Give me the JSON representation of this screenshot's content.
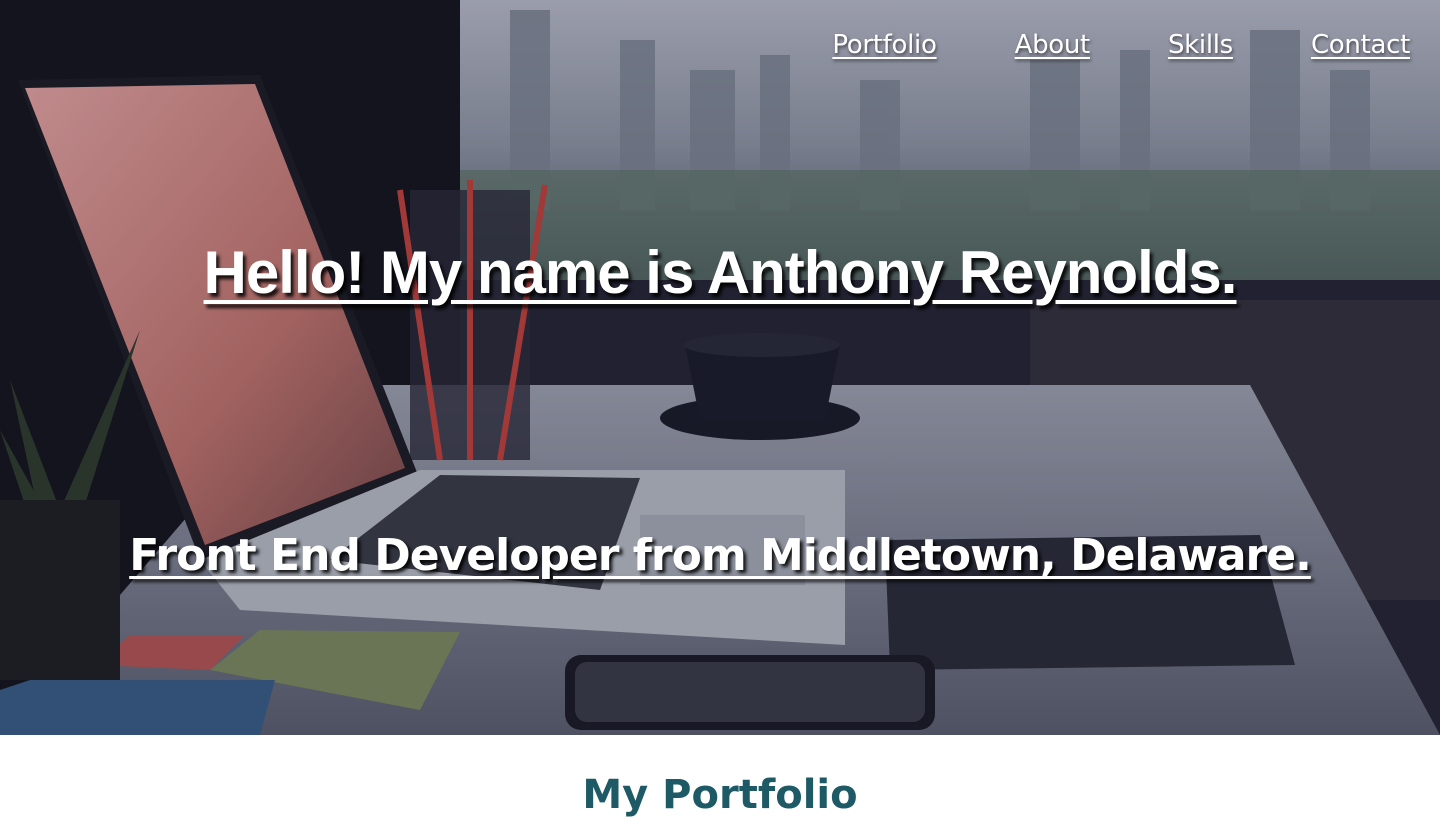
{
  "nav": {
    "items": [
      {
        "label": "Portfolio"
      },
      {
        "label": "About"
      },
      {
        "label": "Skills"
      },
      {
        "label": "Contact"
      }
    ]
  },
  "hero": {
    "title": "Hello! My name is Anthony Reynolds.",
    "subtitle": "Front End Developer from Middletown, Delaware.",
    "background_image": "laptop-desk-city-view"
  },
  "portfolio_section": {
    "heading": "My Portfolio"
  },
  "colors": {
    "nav_text": "#ffffff",
    "hero_text": "#ffffff",
    "section_heading": "#1d5a66",
    "page_background": "#ffffff"
  }
}
